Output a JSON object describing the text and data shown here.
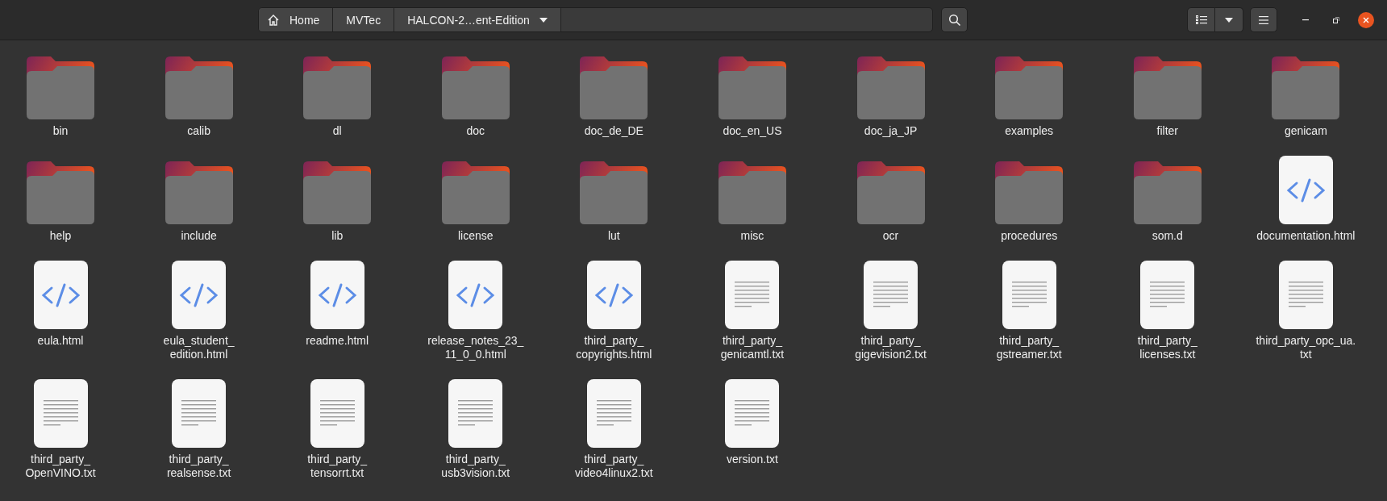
{
  "path_bar": {
    "segments": [
      {
        "label": "Home",
        "kind": "home"
      },
      {
        "label": "MVTec",
        "kind": "plain"
      },
      {
        "label": "HALCON-2…ent-Edition",
        "kind": "menu"
      }
    ]
  },
  "files": [
    {
      "name": "bin",
      "kind": "folder"
    },
    {
      "name": "calib",
      "kind": "folder"
    },
    {
      "name": "dl",
      "kind": "folder"
    },
    {
      "name": "doc",
      "kind": "folder"
    },
    {
      "name": "doc_de_DE",
      "kind": "folder"
    },
    {
      "name": "doc_en_US",
      "kind": "folder"
    },
    {
      "name": "doc_ja_JP",
      "kind": "folder"
    },
    {
      "name": "examples",
      "kind": "folder"
    },
    {
      "name": "filter",
      "kind": "folder"
    },
    {
      "name": "genicam",
      "kind": "folder"
    },
    {
      "name": "help",
      "kind": "folder"
    },
    {
      "name": "include",
      "kind": "folder"
    },
    {
      "name": "lib",
      "kind": "folder"
    },
    {
      "name": "license",
      "kind": "folder"
    },
    {
      "name": "lut",
      "kind": "folder"
    },
    {
      "name": "misc",
      "kind": "folder"
    },
    {
      "name": "ocr",
      "kind": "folder"
    },
    {
      "name": "procedures",
      "kind": "folder"
    },
    {
      "name": "som.d",
      "kind": "folder"
    },
    {
      "name": "documentation.html",
      "kind": "html"
    },
    {
      "name": "eula.html",
      "kind": "html"
    },
    {
      "name": "eula_student_edition.html",
      "kind": "html"
    },
    {
      "name": "readme.html",
      "kind": "html"
    },
    {
      "name": "release_notes_23_11_0_0.html",
      "kind": "html"
    },
    {
      "name": "third_party_copyrights.html",
      "kind": "html"
    },
    {
      "name": "third_party_genicamtl.txt",
      "kind": "text"
    },
    {
      "name": "third_party_gigevision2.txt",
      "kind": "text"
    },
    {
      "name": "third_party_gstreamer.txt",
      "kind": "text"
    },
    {
      "name": "third_party_licenses.txt",
      "kind": "text"
    },
    {
      "name": "third_party_opc_ua.txt",
      "kind": "text"
    },
    {
      "name": "third_party_OpenVINO.txt",
      "kind": "text"
    },
    {
      "name": "third_party_realsense.txt",
      "kind": "text"
    },
    {
      "name": "third_party_tensorrt.txt",
      "kind": "text"
    },
    {
      "name": "third_party_usb3vision.txt",
      "kind": "text"
    },
    {
      "name": "third_party_video4linux2.txt",
      "kind": "text"
    },
    {
      "name": "version.txt",
      "kind": "text"
    }
  ]
}
